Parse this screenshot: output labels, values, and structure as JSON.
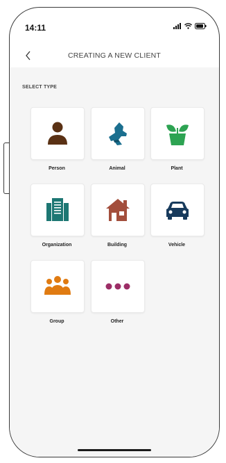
{
  "status_bar": {
    "time": "14:11"
  },
  "header": {
    "title": "CREATING A NEW CLIENT"
  },
  "section_label": "SELECT TYPE",
  "types": [
    {
      "label": "Person",
      "icon": "person-icon",
      "color": "#5a3114"
    },
    {
      "label": "Animal",
      "icon": "dog-icon",
      "color": "#1b6f8f"
    },
    {
      "label": "Plant",
      "icon": "plant-icon",
      "color": "#2da352"
    },
    {
      "label": "Organization",
      "icon": "organization-icon",
      "color": "#1d7773"
    },
    {
      "label": "Building",
      "icon": "house-icon",
      "color": "#a34e3c"
    },
    {
      "label": "Vehicle",
      "icon": "car-icon",
      "color": "#173a5c"
    },
    {
      "label": "Group",
      "icon": "group-icon",
      "color": "#e07b12"
    },
    {
      "label": "Other",
      "icon": "more-dots-icon",
      "color": "#9c2e66"
    }
  ]
}
